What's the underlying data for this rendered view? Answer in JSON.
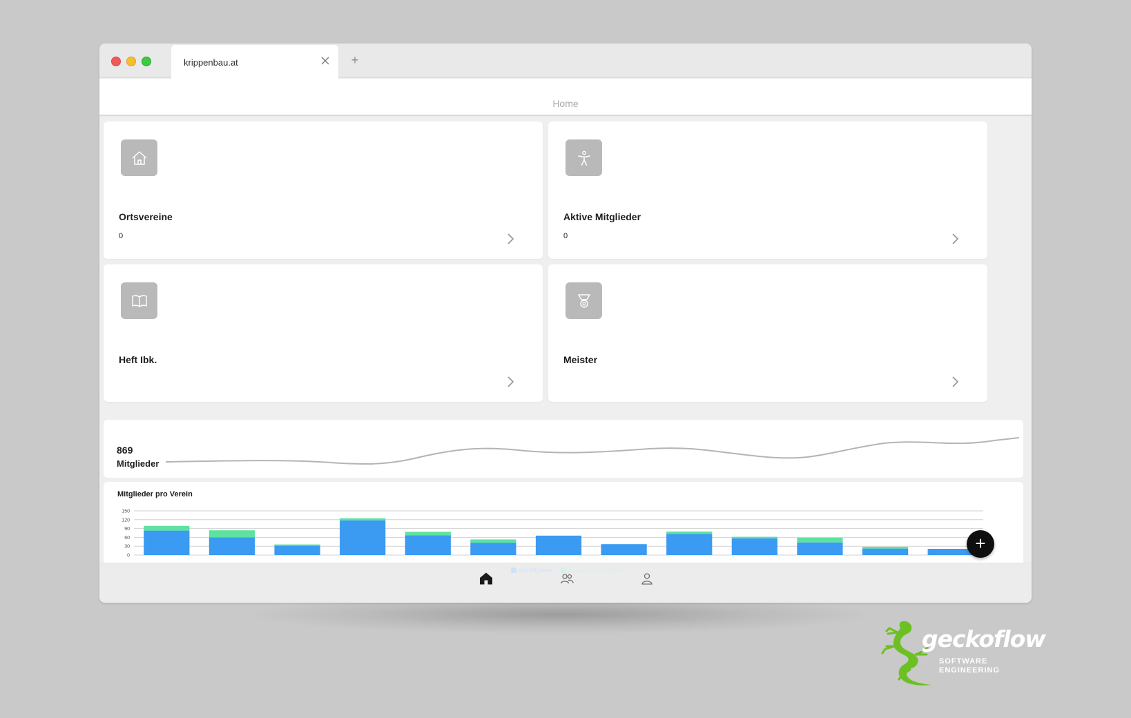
{
  "browser": {
    "tab_title": "krippenbau.at",
    "new_tab_label": "+"
  },
  "header": {
    "title": "Home"
  },
  "cards": [
    {
      "title": "Ortsvereine",
      "count": "0",
      "icon": "house-icon"
    },
    {
      "title": "Aktive Mitglieder",
      "count": "0",
      "icon": "accessibility-person-icon"
    },
    {
      "title": "Heft Ibk.",
      "count": "",
      "icon": "book-icon"
    },
    {
      "title": "Meister",
      "count": "",
      "icon": "medal-icon"
    }
  ],
  "members": {
    "count": "869",
    "label": "Mitglieder"
  },
  "chart_data": {
    "type": "bar",
    "title": "Mitglieder pro Verein",
    "stacked": true,
    "ylim": [
      0,
      150
    ],
    "yticks": [
      0,
      30,
      60,
      90,
      120,
      150
    ],
    "categories": [
      "",
      "",
      "",
      "",
      "",
      "",
      "",
      "",
      "",
      "",
      "",
      "",
      ""
    ],
    "series": [
      {
        "name": "Voll Mitglieder",
        "color": "#3b9af2",
        "values": [
          83,
          60,
          32,
          118,
          67,
          42,
          66,
          37,
          72,
          57,
          43,
          22,
          21
        ]
      },
      {
        "name": "Jugend/Junior Mitglieder",
        "color": "#5de2a0",
        "values": [
          16,
          24,
          4,
          7,
          12,
          11,
          0,
          0,
          8,
          5,
          16,
          6,
          0
        ]
      }
    ],
    "grid": true
  },
  "sparkline": {
    "color": "#b4b4b4"
  },
  "fab": {
    "label": "+"
  },
  "legend": {
    "item1": "Voll Mitglieder",
    "item2": "Jugend/Junior Mitglieder"
  },
  "nav": {
    "items": [
      "home-icon",
      "group-icon",
      "user-icon"
    ]
  },
  "logo": {
    "name": "geckoflow",
    "line1": "SOFTWARE",
    "line2": "ENGINEERING",
    "color": "#6cc024"
  }
}
